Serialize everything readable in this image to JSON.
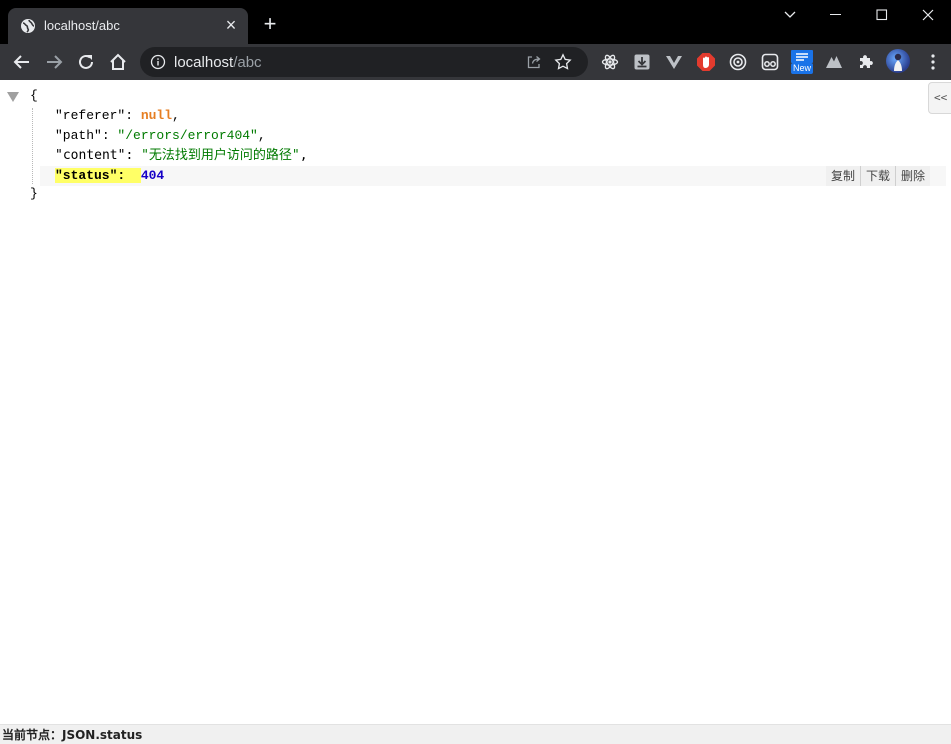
{
  "tab": {
    "title": "localhost/abc",
    "favicon": "globe-icon",
    "close": "×",
    "new_tab": "+"
  },
  "omnibox": {
    "host": "localhost",
    "path": "/abc"
  },
  "extensions": {
    "new_badge": "New"
  },
  "json_view": {
    "open_brace": "{",
    "close_brace": "}",
    "lines": [
      {
        "key": "\"referer\"",
        "value": "null",
        "type": "null",
        "trail": ","
      },
      {
        "key": "\"path\"",
        "value": "\"/errors/error404\"",
        "type": "string",
        "trail": ","
      },
      {
        "key": "\"content\"",
        "value": "\"无法找到用户访问的路径\"",
        "type": "string",
        "trail": ","
      },
      {
        "key": "\"status\"",
        "value": "404",
        "type": "number",
        "trail": ""
      }
    ],
    "actions": {
      "copy": "复制",
      "download": "下载",
      "delete": "删除"
    },
    "side_toggle": "<<"
  },
  "status_bar": {
    "text": "当前节点：JSON.status"
  },
  "colors": {
    "titlebar": "#000000",
    "toolbar": "#35363a",
    "omnibox": "#202124",
    "null": "#e67e22",
    "string": "#007a00",
    "number": "#1500c6",
    "highlight": "#ffff66"
  }
}
